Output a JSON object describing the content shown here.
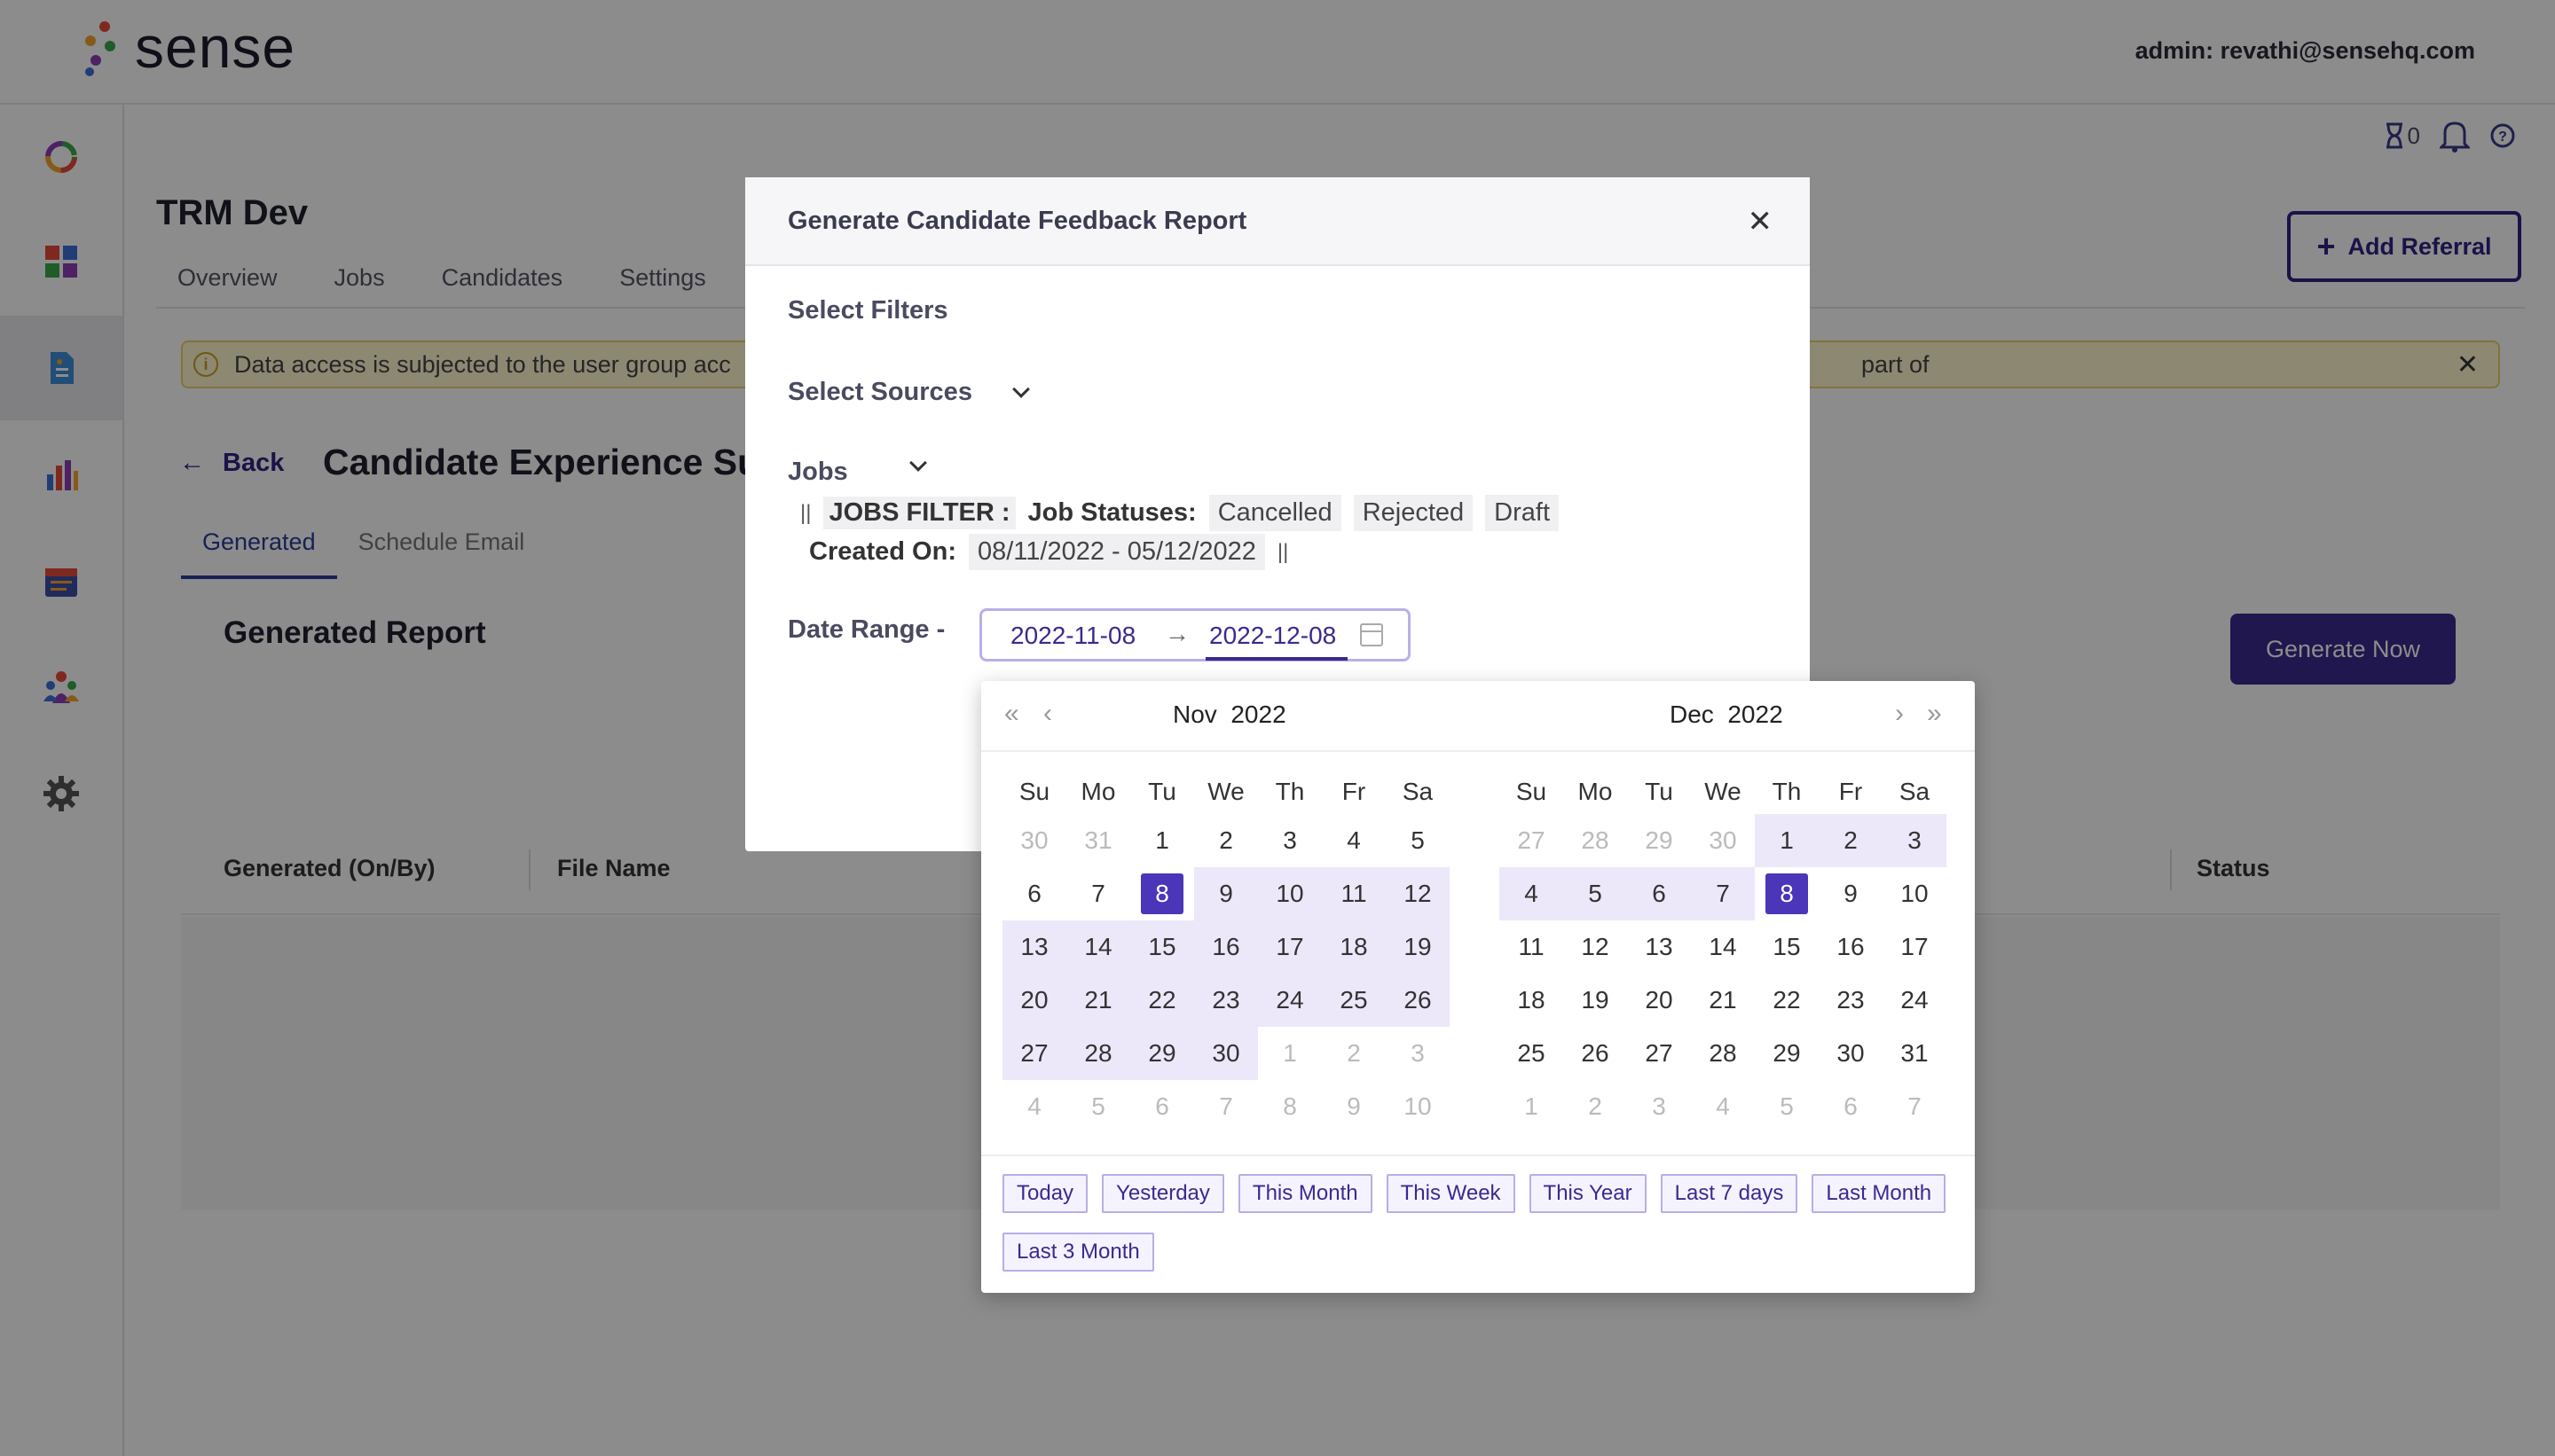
{
  "header": {
    "logo_text": "sense",
    "admin_label": "admin: revathi@sensehq.com"
  },
  "sidebar": {
    "items": [
      {
        "name": "dashboard-ring-icon"
      },
      {
        "name": "apps-grid-icon"
      },
      {
        "name": "report-document-icon"
      },
      {
        "name": "analytics-bar-icon"
      },
      {
        "name": "calendar-icon"
      },
      {
        "name": "people-icon"
      },
      {
        "name": "settings-gear-icon"
      }
    ]
  },
  "top_utils": {
    "hourglass_count": "0"
  },
  "page": {
    "company": "TRM Dev",
    "tabs": [
      "Overview",
      "Jobs",
      "Candidates",
      "Settings"
    ],
    "add_referral": "Add Referral",
    "banner_left": "Data access is subjected to the user group acc",
    "banner_right": "part of",
    "back_label": "Back",
    "title": "Candidate Experience Su",
    "sub_tabs": [
      "Generated",
      "Schedule Email"
    ],
    "generated_report": "Generated Report",
    "generate_now": "Generate Now",
    "table_headers": [
      "Generated (On/By)",
      "File Name",
      "Status"
    ]
  },
  "modal": {
    "title": "Generate Candidate Feedback Report",
    "select_filters": "Select Filters",
    "select_sources": "Select Sources",
    "jobs": "Jobs",
    "jobs_filter_label": "JOBS FILTER :",
    "job_statuses_label": "Job Statuses:",
    "job_statuses": [
      "Cancelled",
      "Rejected",
      "Draft"
    ],
    "created_on_label": "Created On:",
    "created_on_value": "08/11/2022 - 05/12/2022",
    "separator": "||",
    "date_range_label": "Date Range -",
    "date_start": "2022-11-08",
    "date_arrow": "→",
    "date_end": "2022-12-08"
  },
  "picker": {
    "left_month": "Nov",
    "left_year": "2022",
    "right_month": "Dec",
    "right_year": "2022",
    "days_of_week": [
      "Su",
      "Mo",
      "Tu",
      "We",
      "Th",
      "Fr",
      "Sa"
    ],
    "left_weeks": [
      [
        [
          "30",
          "out"
        ],
        [
          "31",
          "out"
        ],
        [
          "1",
          ""
        ],
        [
          "2",
          ""
        ],
        [
          "3",
          ""
        ],
        [
          "4",
          ""
        ],
        [
          "5",
          ""
        ]
      ],
      [
        [
          "6",
          ""
        ],
        [
          "7",
          ""
        ],
        [
          "8",
          "sel"
        ],
        [
          "9",
          "in"
        ],
        [
          "10",
          "in"
        ],
        [
          "11",
          "in"
        ],
        [
          "12",
          "in"
        ]
      ],
      [
        [
          "13",
          "in"
        ],
        [
          "14",
          "in"
        ],
        [
          "15",
          "in"
        ],
        [
          "16",
          "in"
        ],
        [
          "17",
          "in"
        ],
        [
          "18",
          "in"
        ],
        [
          "19",
          "in"
        ]
      ],
      [
        [
          "20",
          "in"
        ],
        [
          "21",
          "in"
        ],
        [
          "22",
          "in"
        ],
        [
          "23",
          "in"
        ],
        [
          "24",
          "in"
        ],
        [
          "25",
          "in"
        ],
        [
          "26",
          "in"
        ]
      ],
      [
        [
          "27",
          "in"
        ],
        [
          "28",
          "in"
        ],
        [
          "29",
          "in"
        ],
        [
          "30",
          "in"
        ],
        [
          "1",
          "out"
        ],
        [
          "2",
          "out"
        ],
        [
          "3",
          "out"
        ]
      ],
      [
        [
          "4",
          "out"
        ],
        [
          "5",
          "out"
        ],
        [
          "6",
          "out"
        ],
        [
          "7",
          "out"
        ],
        [
          "8",
          "out"
        ],
        [
          "9",
          "out"
        ],
        [
          "10",
          "out"
        ]
      ]
    ],
    "right_weeks": [
      [
        [
          "27",
          "out"
        ],
        [
          "28",
          "out"
        ],
        [
          "29",
          "out"
        ],
        [
          "30",
          "out"
        ],
        [
          "1",
          "in"
        ],
        [
          "2",
          "in"
        ],
        [
          "3",
          "in"
        ]
      ],
      [
        [
          "4",
          "in"
        ],
        [
          "5",
          "in"
        ],
        [
          "6",
          "in"
        ],
        [
          "7",
          "in"
        ],
        [
          "8",
          "sel"
        ],
        [
          "9",
          ""
        ],
        [
          "10",
          ""
        ]
      ],
      [
        [
          "11",
          ""
        ],
        [
          "12",
          ""
        ],
        [
          "13",
          ""
        ],
        [
          "14",
          ""
        ],
        [
          "15",
          ""
        ],
        [
          "16",
          ""
        ],
        [
          "17",
          ""
        ]
      ],
      [
        [
          "18",
          ""
        ],
        [
          "19",
          ""
        ],
        [
          "20",
          ""
        ],
        [
          "21",
          ""
        ],
        [
          "22",
          ""
        ],
        [
          "23",
          ""
        ],
        [
          "24",
          ""
        ]
      ],
      [
        [
          "25",
          ""
        ],
        [
          "26",
          ""
        ],
        [
          "27",
          ""
        ],
        [
          "28",
          ""
        ],
        [
          "29",
          ""
        ],
        [
          "30",
          ""
        ],
        [
          "31",
          ""
        ]
      ],
      [
        [
          "1",
          "out"
        ],
        [
          "2",
          "out"
        ],
        [
          "3",
          "out"
        ],
        [
          "4",
          "out"
        ],
        [
          "5",
          "out"
        ],
        [
          "6",
          "out"
        ],
        [
          "7",
          "out"
        ]
      ]
    ],
    "presets": [
      "Today",
      "Yesterday",
      "This Month",
      "This Week",
      "This Year",
      "Last 7 days",
      "Last Month",
      "Last 3 Month"
    ]
  },
  "colors": {
    "brand_primary": "#3a2a8f",
    "selected_day": "#4b35b8",
    "range_bg": "#ece8fa",
    "banner_bg": "#fff8d0"
  }
}
